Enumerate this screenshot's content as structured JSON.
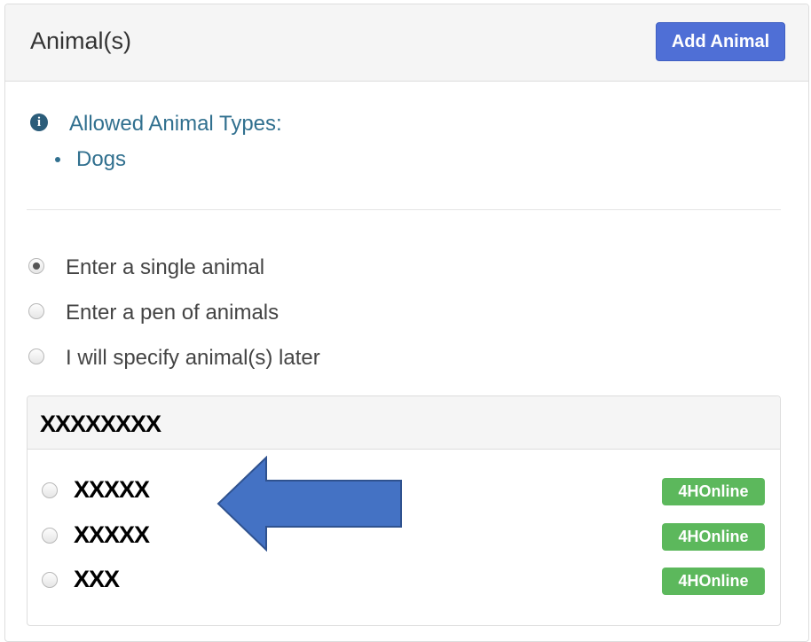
{
  "panel": {
    "title": "Animal(s)",
    "add_button_label": "Add Animal"
  },
  "info": {
    "icon": "info-circle-icon",
    "label": "Allowed Animal Types:",
    "allowed_types": [
      "Dogs"
    ],
    "color": "#31708f"
  },
  "entry_options": [
    {
      "label": "Enter a single animal",
      "selected": true
    },
    {
      "label": "Enter a pen of animals",
      "selected": false
    },
    {
      "label": "I will specify animal(s) later",
      "selected": false
    }
  ],
  "animals_panel": {
    "title": "XXXXXXXX",
    "animals": [
      {
        "name": "XXXXX",
        "badge": "4HOnline"
      },
      {
        "name": "XXXXX",
        "badge": "4HOnline"
      },
      {
        "name": "XXX",
        "badge": "4HOnline"
      }
    ]
  },
  "colors": {
    "primary_button": "#4f6fd6",
    "badge_green": "#5cb85c",
    "arrow_blue": "#4472c4"
  }
}
